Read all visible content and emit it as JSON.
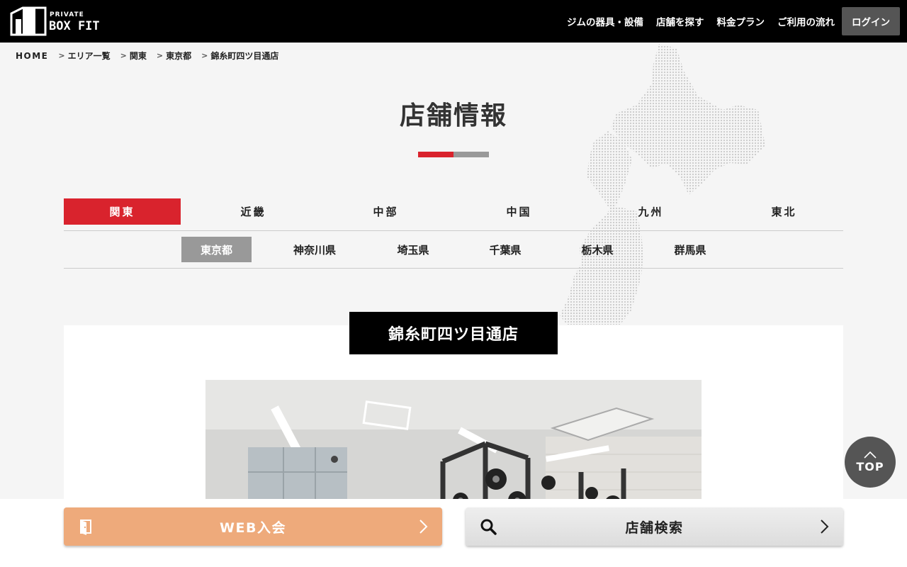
{
  "header": {
    "logo_small": "PRIVATE",
    "logo_big": "BOX FIT",
    "nav": [
      "ジムの器具・設備",
      "店舗を探す",
      "料金プラン",
      "ご利用の流れ"
    ],
    "login": "ログイン"
  },
  "breadcrumb": {
    "home": "HOME",
    "items": [
      "エリア一覧",
      "関東",
      "東京都",
      "錦糸町四ツ目通店"
    ]
  },
  "page_title": "店舗情報",
  "regions": {
    "active_index": 0,
    "items": [
      "関東",
      "近畿",
      "中部",
      "中国",
      "九州",
      "東北"
    ]
  },
  "prefectures": {
    "active_index": 0,
    "items": [
      "東京都",
      "神奈川県",
      "埼玉県",
      "千葉県",
      "栃木県",
      "群馬県"
    ]
  },
  "store": {
    "name": "錦糸町四ツ目通店"
  },
  "top_button": "TOP",
  "bottom": {
    "join": "WEB入会",
    "search": "店舗検索"
  },
  "colors": {
    "accent_red": "#d9232d",
    "join_orange": "#eeaa7b",
    "header_black": "#000000",
    "inactive_gray": "#999999"
  },
  "icons": [
    "door-icon",
    "search-icon",
    "chevron-right-icon",
    "chevron-up-icon"
  ]
}
